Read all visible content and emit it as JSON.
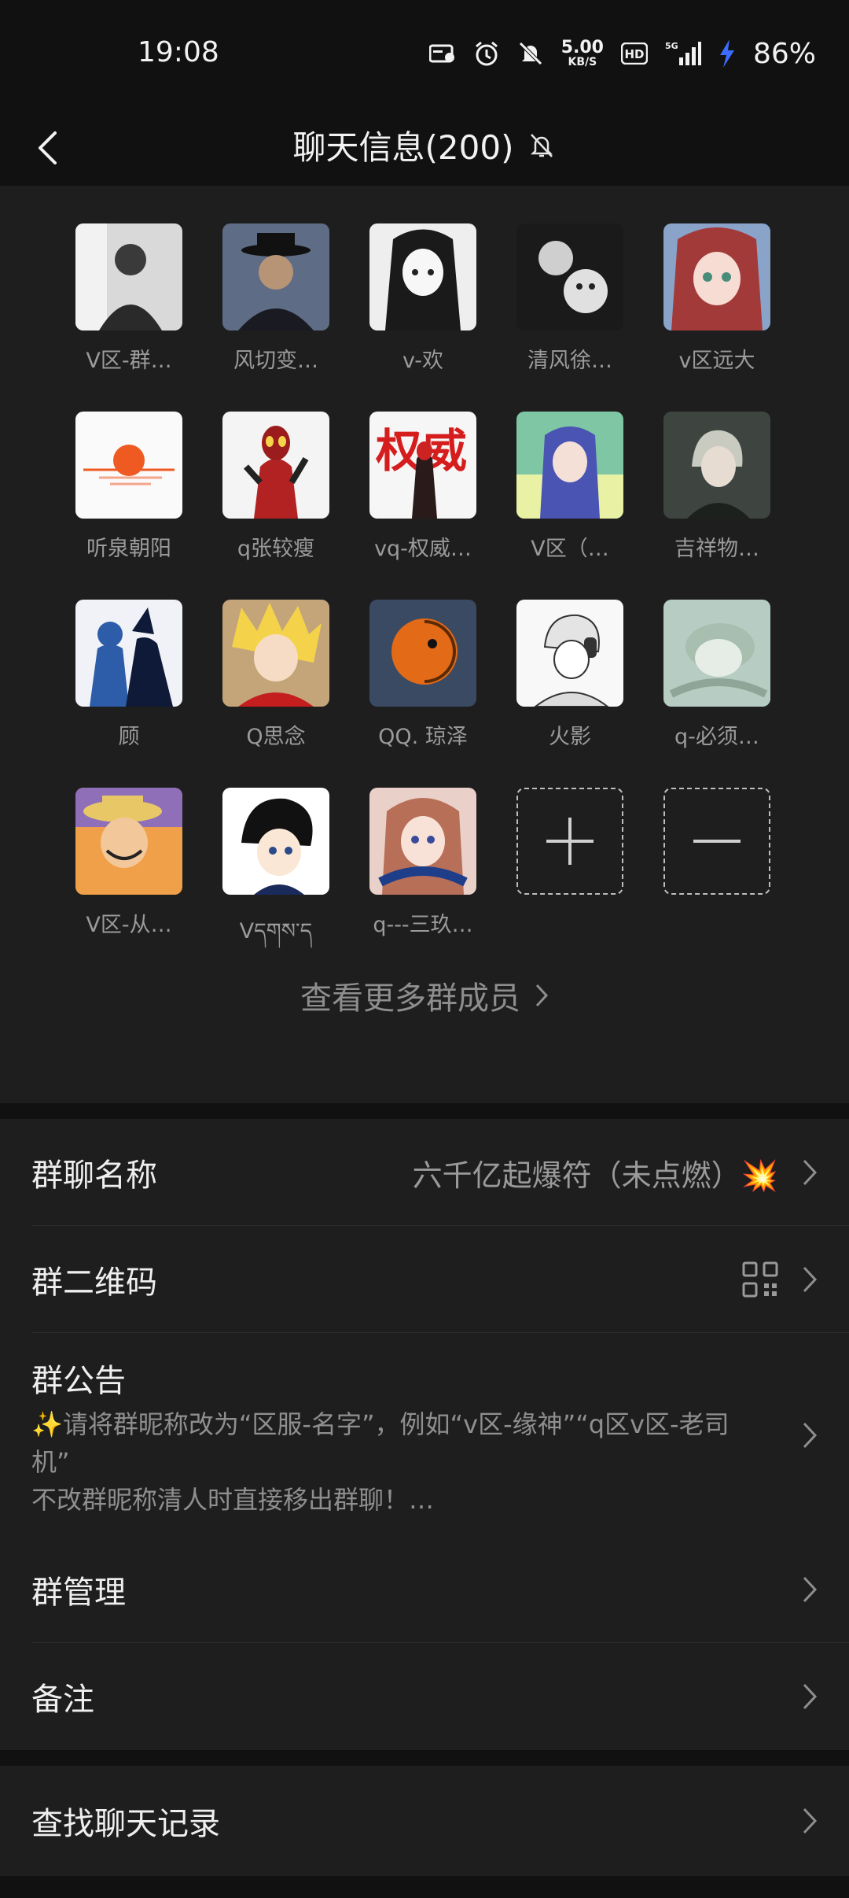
{
  "status_bar": {
    "time": "19:08",
    "net_speed_value": "5.00",
    "net_speed_unit": "KB/S",
    "hd": "HD",
    "signal": "5G",
    "battery": "86%"
  },
  "header": {
    "title": "聊天信息(200)"
  },
  "members": [
    {
      "name": "V区-群…",
      "avatar": "photo-man-suit"
    },
    {
      "name": "风切变…",
      "avatar": "photo-man-hat"
    },
    {
      "name": "v-欢",
      "avatar": "anime-girl-bw"
    },
    {
      "name": "清风徐…",
      "avatar": "photo-man-dog"
    },
    {
      "name": "v区远大",
      "avatar": "anime-girl-redhair"
    },
    {
      "name": "听泉朝阳",
      "avatar": "sunrise-painting"
    },
    {
      "name": "q张较瘦",
      "avatar": "ultraman-red"
    },
    {
      "name": "vq-权威…",
      "avatar": "ultraman-calligraphy"
    },
    {
      "name": "V区（…",
      "avatar": "anime-blue-hair"
    },
    {
      "name": "吉祥物…",
      "avatar": "anime-dark-boy"
    },
    {
      "name": "顾",
      "avatar": "silhouette-couple"
    },
    {
      "name": "Q思念",
      "avatar": "anime-blonde"
    },
    {
      "name": "QQ. 琼泽",
      "avatar": "anime-orange-mask"
    },
    {
      "name": "火影",
      "avatar": "anime-headphones"
    },
    {
      "name": "q-必须…",
      "avatar": "anime-sleeping"
    },
    {
      "name": "V区-从…",
      "avatar": "anime-straw-hat"
    },
    {
      "name": "Vདགས་ད",
      "avatar": "anime-detective"
    },
    {
      "name": "q---三玖…",
      "avatar": "anime-headphones-girl"
    }
  ],
  "more_members": "查看更多群成员",
  "settings": {
    "group_name_label": "群聊名称",
    "group_name_value": "六千亿起爆符（未点燃）💥",
    "qr_label": "群二维码",
    "notice_label": "群公告",
    "notice_text": "✨请将群昵称改为“区服-名字”，例如“v区-缘神”“q区v区-老司机”",
    "notice_text2": "不改群昵称清人时直接移出群聊！…",
    "manage_label": "群管理",
    "remark_label": "备注",
    "search_label": "查找聊天记录"
  },
  "colors": {
    "background": "#111111",
    "panel": "#1e1e1e",
    "text_primary": "#efefef",
    "text_secondary": "#9a9a9a",
    "charging": "#3b6cff"
  }
}
